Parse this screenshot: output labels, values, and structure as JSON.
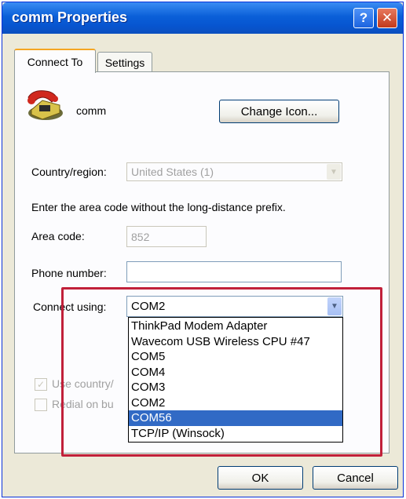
{
  "window": {
    "title": "comm Properties",
    "help_glyph": "?",
    "close_glyph": "✕"
  },
  "tabs": [
    {
      "label": "Connect To",
      "active": true
    },
    {
      "label": "Settings",
      "active": false
    }
  ],
  "connection": {
    "name": "comm",
    "icon": "phone-icon",
    "change_icon_button": "Change Icon..."
  },
  "country": {
    "label": "Country/region:",
    "value": "United States (1)"
  },
  "instruction": "Enter the area code without the long-distance prefix.",
  "area_code": {
    "label": "Area code:",
    "value": "852"
  },
  "phone_number": {
    "label": "Phone number:",
    "value": ""
  },
  "connect_using": {
    "label": "Connect using:",
    "value": "COM2",
    "options": [
      "ThinkPad Modem Adapter",
      "Wavecom USB Wireless CPU #47",
      "COM5",
      "COM4",
      "COM3",
      "COM2",
      "COM56",
      "TCP/IP (Winsock)"
    ],
    "highlighted_option": "COM56"
  },
  "checkboxes": [
    {
      "label": "Use country/",
      "checked": true
    },
    {
      "label": "Redial on bu",
      "checked": false
    }
  ],
  "footer": {
    "ok": "OK",
    "cancel": "Cancel"
  },
  "colors": {
    "titlebar": "#0a5fd8",
    "annotation": "#c1203a",
    "selection": "#316ac5"
  }
}
